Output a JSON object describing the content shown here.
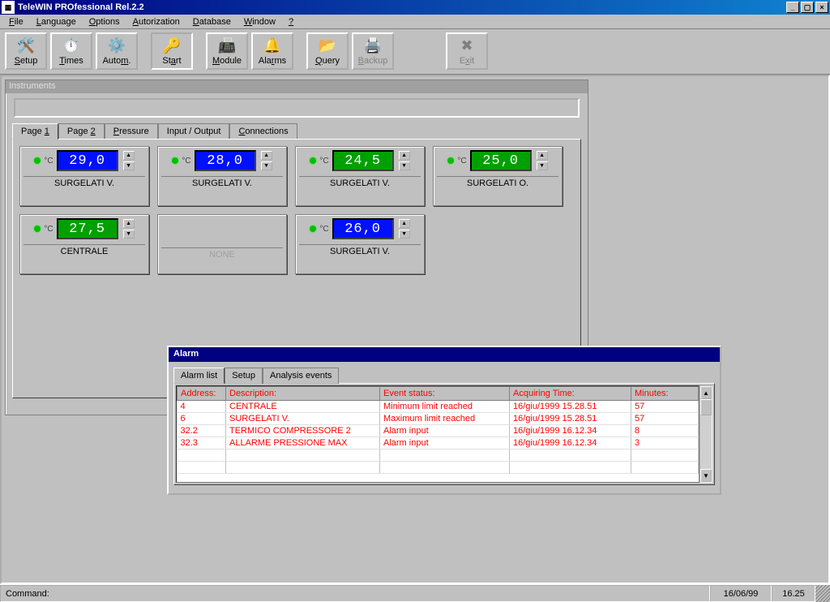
{
  "window": {
    "title": "TeleWIN PROfessional Rel.2.2"
  },
  "menu": {
    "file": "File",
    "language": "Language",
    "options": "Options",
    "autorization": "Autorization",
    "database": "Database",
    "window": "Window",
    "help": "?"
  },
  "toolbar": {
    "setup": "Setup",
    "times": "Times",
    "autom": "Autom.",
    "start": "Start",
    "module": "Module",
    "alarms": "Alarms",
    "query": "Query",
    "backup": "Backup",
    "exit": "Exit"
  },
  "instruments": {
    "title": "Instruments",
    "tabs": {
      "page1": "Page 1",
      "page2": "Page 2",
      "pressure": "Pressure",
      "io": "Input / Output",
      "connections": "Connections"
    },
    "unit": "°C",
    "cards": [
      {
        "value": "29,0",
        "label": "SURGELATI V.",
        "color": "blue"
      },
      {
        "value": "28,0",
        "label": "SURGELATI V.",
        "color": "blue"
      },
      {
        "value": "24,5",
        "label": "SURGELATI V.",
        "color": "green"
      },
      {
        "value": "25,0",
        "label": "SURGELATI O.",
        "color": "green"
      },
      {
        "value": "27,5",
        "label": "CENTRALE",
        "color": "green"
      },
      {
        "value": "",
        "label": "NONE",
        "color": "none"
      },
      {
        "value": "26,0",
        "label": "SURGELATI V.",
        "color": "blue"
      }
    ]
  },
  "alarm": {
    "title": "Alarm",
    "tabs": {
      "list": "Alarm list",
      "setup": "Setup",
      "analysis": "Analysis events"
    },
    "headers": {
      "address": "Address:",
      "description": "Description:",
      "status": "Event status:",
      "time": "Acquiring Time:",
      "minutes": "Minutes:"
    },
    "rows": [
      {
        "address": "4",
        "description": "CENTRALE",
        "status": "Minimum limit reached",
        "time": "16/giu/1999 15.28.51",
        "minutes": "57"
      },
      {
        "address": "6",
        "description": "SURGELATI V.",
        "status": "Maximum limit reached",
        "time": "16/giu/1999 15.28.51",
        "minutes": "57"
      },
      {
        "address": "32.2",
        "description": "TERMICO COMPRESSORE 2",
        "status": "Alarm input",
        "time": "16/giu/1999 16.12.34",
        "minutes": "8"
      },
      {
        "address": "32.3",
        "description": "ALLARME PRESSIONE MAX",
        "status": "Alarm input",
        "time": "16/giu/1999 16.12.34",
        "minutes": "3"
      }
    ]
  },
  "statusbar": {
    "command": "Command:",
    "date": "16/06/99",
    "time": "16.25"
  }
}
